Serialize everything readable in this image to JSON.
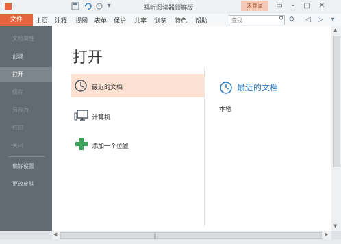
{
  "titlebar": {
    "title": "福昕阅读器领鲜版",
    "login": "未登录",
    "icons": [
      "save-icon",
      "undo-icon",
      "hand-icon",
      "dropdown-icon"
    ]
  },
  "menu": {
    "file": "文件",
    "items": [
      "主页",
      "注释",
      "视图",
      "表单",
      "保护",
      "共享",
      "浏览",
      "特色",
      "帮助"
    ],
    "search_placeholder": "查找"
  },
  "sidebar": {
    "items": [
      {
        "label": "文档属性",
        "state": "disabled"
      },
      {
        "label": "创建",
        "state": "normal"
      },
      {
        "label": "打开",
        "state": "active"
      },
      {
        "label": "保存",
        "state": "disabled"
      },
      {
        "label": "另存为",
        "state": "disabled"
      },
      {
        "label": "打印",
        "state": "disabled"
      },
      {
        "label": "关闭",
        "state": "disabled"
      },
      {
        "label": "偏好设置",
        "state": "normal"
      },
      {
        "label": "更改皮肤",
        "state": "normal"
      }
    ]
  },
  "main": {
    "heading": "打开",
    "options": [
      {
        "label": "最近的文档",
        "icon": "clock-icon",
        "selected": true
      },
      {
        "label": "计算机",
        "icon": "computer-icon",
        "selected": false
      },
      {
        "label": "添加一个位置",
        "icon": "plus-icon",
        "selected": false
      }
    ],
    "right_title": "最近的文档",
    "right_sub": "本地"
  },
  "colors": {
    "accent": "#e6643d",
    "sidebar": "#626b72",
    "selected": "#fde1d2",
    "link_blue": "#2b78c0",
    "plus_green": "#3aa35c"
  }
}
